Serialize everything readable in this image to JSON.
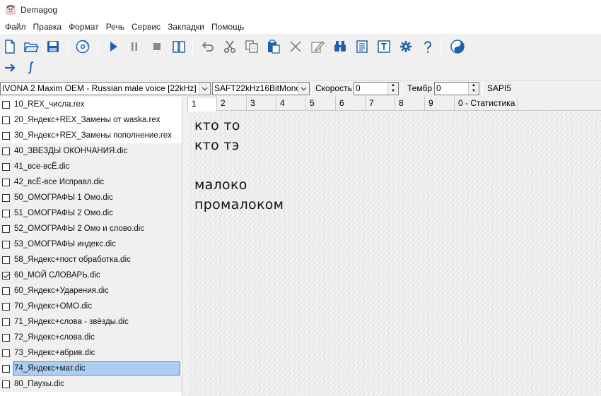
{
  "window": {
    "title": "Demagog"
  },
  "menu": [
    "Файл",
    "Правка",
    "Формат",
    "Речь",
    "Сервис",
    "Закладки",
    "Помощь"
  ],
  "toolbar": {
    "row1": [
      "new-file-icon",
      "open-folder-icon",
      "save-icon",
      "cd-icon",
      "play-icon",
      "pause-icon",
      "stop-icon",
      "book-icon",
      "undo-icon",
      "cut-icon",
      "copy-icon",
      "paste-icon",
      "delete-icon",
      "edit-icon",
      "find-icon",
      "document-icon",
      "text-icon",
      "gear-icon",
      "help-icon",
      "yin-yang-icon"
    ],
    "row2": [
      "arrow-right-icon",
      "integral-icon"
    ]
  },
  "voicebar": {
    "voice": "IVONA 2 Maxim OEM - Russian male voice [22kHz]",
    "format": "SAFT22kHz16BitMono",
    "speed_label": "Скорость",
    "speed_value": "0",
    "timbre_label": "Тембр",
    "timbre_value": "0",
    "engine": "SAPI5"
  },
  "dictionary_list": [
    {
      "label": "10_REX_числа.rex",
      "checked": false
    },
    {
      "label": "20_Яндекс+REX_Замены от waska.rex",
      "checked": false
    },
    {
      "label": "30_Яндекс+REX_Замены пополнение.rex",
      "checked": false
    },
    {
      "label": "40_ЗВЕЗДЫ ОКОНЧАНИЯ.dic",
      "checked": false
    },
    {
      "label": "41_все-всЁ.dic",
      "checked": false
    },
    {
      "label": "42_всЁ-все Исправл.dic",
      "checked": false
    },
    {
      "label": "50_ОМОГРАФЫ 1 Омо.dic",
      "checked": false
    },
    {
      "label": "51_ОМОГРАФЫ 2 Омо.dic",
      "checked": false
    },
    {
      "label": "52_ОМОГРАФЫ 2 Омо и слово.dic",
      "checked": false
    },
    {
      "label": "53_ОМОГРАФЫ индекс.dic",
      "checked": false
    },
    {
      "label": "58_Яндекс+пост обработка.dic",
      "checked": false
    },
    {
      "label": "60_МОЙ СЛОВАРЬ.dic",
      "checked": true
    },
    {
      "label": "60_Яндекс+Ударения.dic",
      "checked": false
    },
    {
      "label": "70_Яндекс+ОМО.dic",
      "checked": false
    },
    {
      "label": "71_Яндекс+слова - звёзды.dic",
      "checked": false
    },
    {
      "label": "72_Яндекс+слова.dic",
      "checked": false
    },
    {
      "label": "73_Яндекс+абрив.dic",
      "checked": false
    },
    {
      "label": "74_Яндекс+мат.dic",
      "checked": false,
      "selected": true
    },
    {
      "label": "80_Паузы.dic",
      "checked": false
    }
  ],
  "tabs": [
    "1",
    "2",
    "3",
    "4",
    "5",
    "6",
    "7",
    "8",
    "9",
    "0 - Статистика"
  ],
  "active_tab": "1",
  "editor_lines": [
    "кто то",
    "кто тэ",
    "",
    "малоко",
    "промалоком"
  ]
}
